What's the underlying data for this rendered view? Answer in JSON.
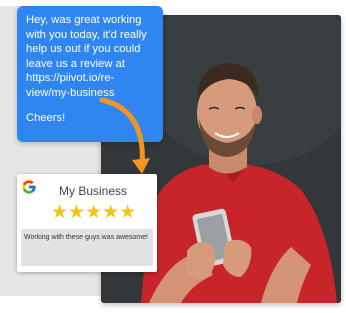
{
  "message": {
    "text": "Hey, was great working with you today, it'd really help us out if you could leave us a review at https://piivot.io/re-view/my-business",
    "signoff": "Cheers!"
  },
  "review_card": {
    "icon": "google-g-icon",
    "business_name": "My Business",
    "stars": "★★★★★",
    "rating": 5,
    "review_text": "Working with these guys was awesome!"
  },
  "colors": {
    "bubble": "#2f86f0",
    "arrow": "#f39422",
    "stars": "#f6c416"
  }
}
